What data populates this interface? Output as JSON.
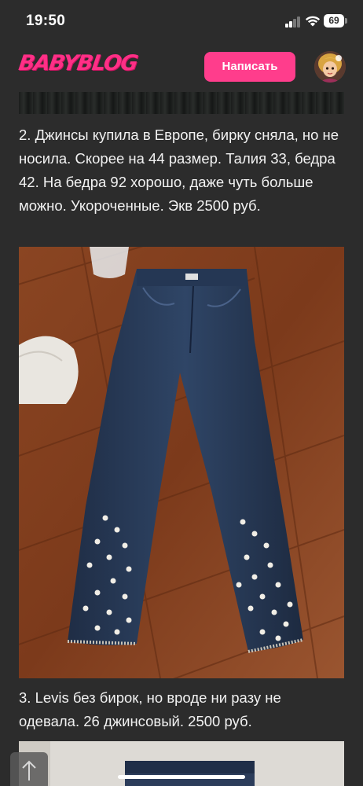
{
  "status_bar": {
    "time": "19:50",
    "battery": "69"
  },
  "header": {
    "logo": "BABYBLOG",
    "write_button": "Написать"
  },
  "post": {
    "paragraph_1": "2. Джинсы купила в Европе, бирку сняла, но не носила. Скорее на 44 размер. Талия 33, бедра 42. На бедра 92 хорошо, даже чуть больше можно. Укороченные. Экв 2500 руб.",
    "paragraph_2": "3. Levis без бирок, но вроде ни разу не одевала. 26 джинсовый. 2500 руб."
  },
  "icons": {
    "scroll_top": "arrow-up-icon",
    "signal": "signal-icon",
    "wifi": "wifi-icon",
    "battery": "battery-icon"
  },
  "colors": {
    "background": "#2c2c2c",
    "brand": "#ff2f86",
    "button": "#ff3d8c"
  }
}
